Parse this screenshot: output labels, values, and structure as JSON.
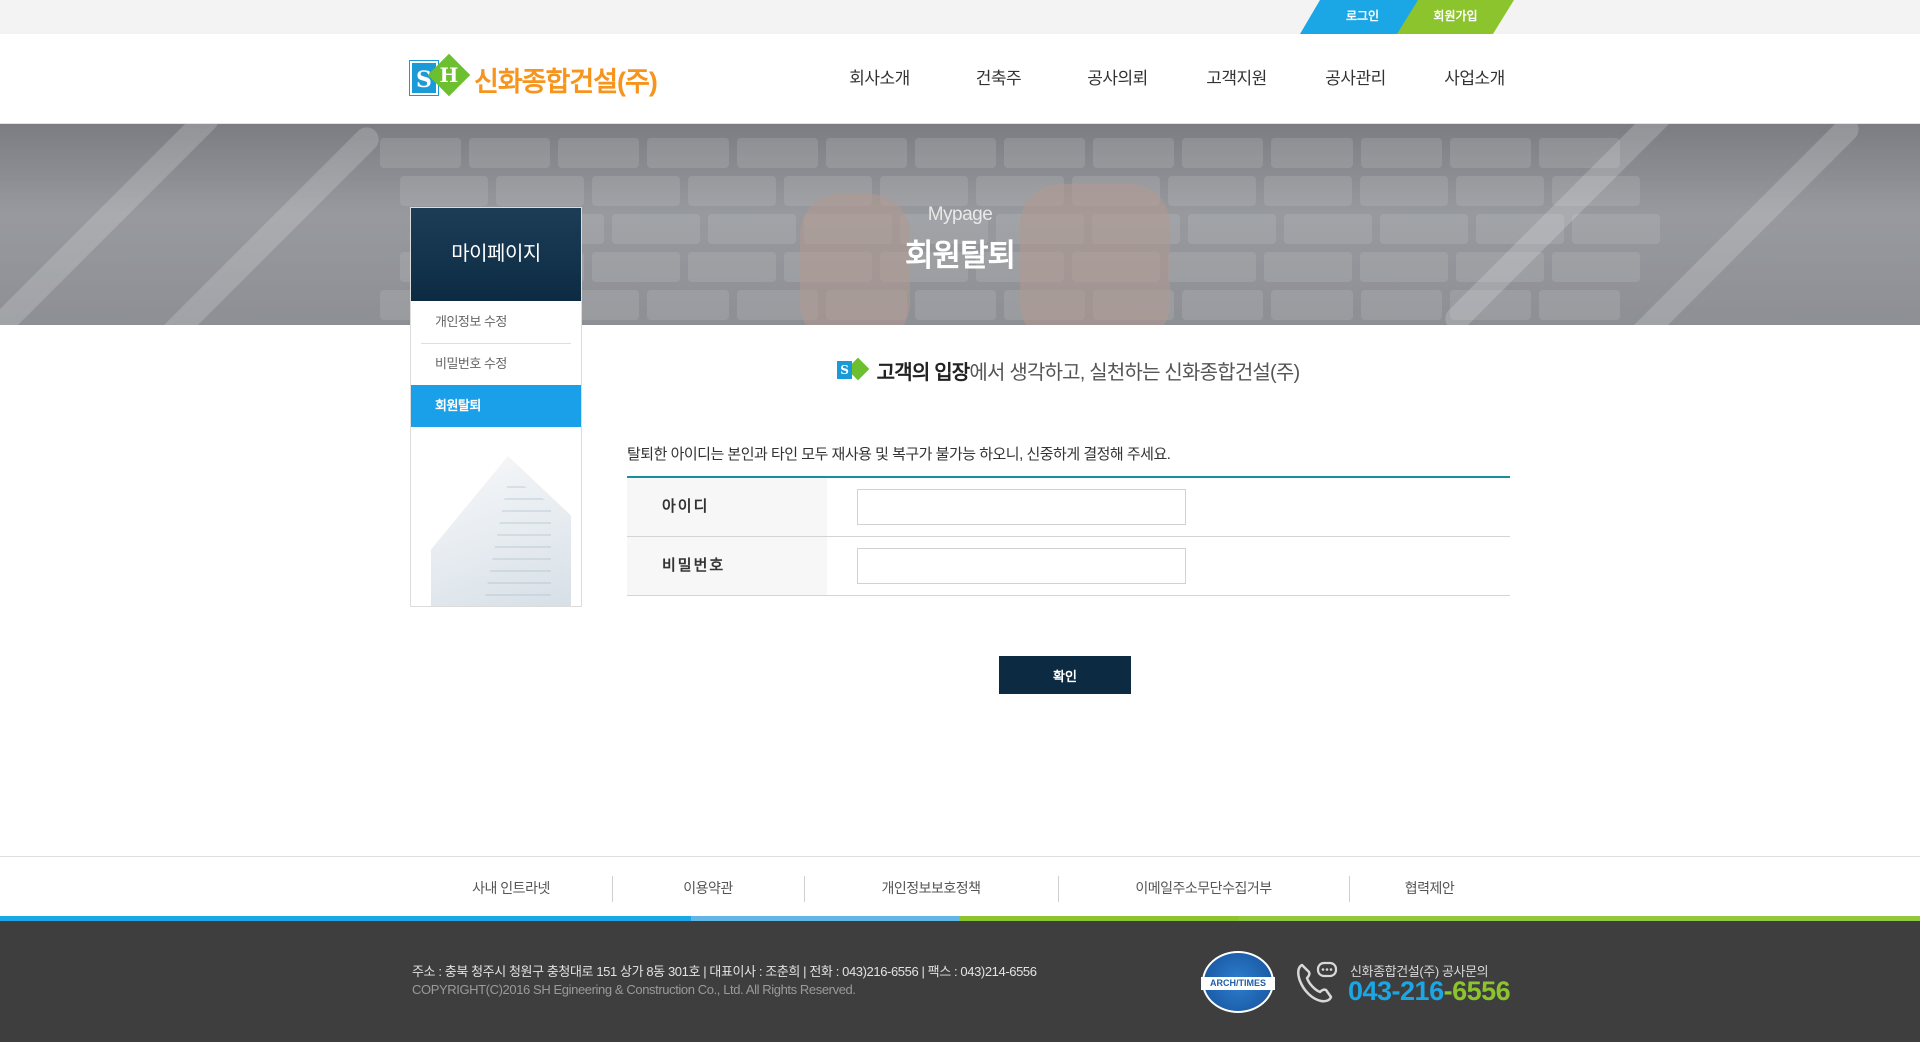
{
  "top": {
    "login": "로그인",
    "join": "회원가입"
  },
  "brand": {
    "s": "S",
    "h": "H",
    "name": "신화종합건설(주)"
  },
  "gnb": [
    "회사소개",
    "건축주",
    "공사의뢰",
    "고객지원",
    "공사관리",
    "사업소개"
  ],
  "banner": {
    "en": "Mypage",
    "ko": "회원탈퇴"
  },
  "side": {
    "title": "마이페이지",
    "items": [
      "개인정보 수정",
      "비밀번호 수정",
      "회원탈퇴"
    ]
  },
  "content": {
    "slogan_strong": "고객의 입장",
    "slogan_rest": "에서 생각하고, 실천하는 신화종합건설(주)",
    "notice": "탈퇴한 아이디는 본인과 타인 모두 재사용 및 복구가 불가능 하오니, 신중하게 결정해 주세요.",
    "fields": [
      {
        "label": "아이디",
        "value": ""
      },
      {
        "label": "비밀번호",
        "value": ""
      }
    ],
    "confirm": "확인"
  },
  "footer": {
    "links": [
      "사내 인트라넷",
      "이용약관",
      "개인정보보호정책",
      "이메일주소무단수집거부",
      "협력제안"
    ],
    "address": "주소 : 충북 청주시 청원구 충청대로 151 상가 8동 301호   |   대표이사 : 조춘희   |   전화 : 043)216-6556   |   팩스 : 043)214-6556",
    "copyright": "COPYRIGHT(C)2016  SH Egineering & Construction  Co., Ltd. All Rights Reserved.",
    "seal_text": "ARCH/TIMES",
    "cs_label": "신화종합건설(주) 공사문의",
    "cs_phone_a": "043-216",
    "cs_phone_b": "-6556"
  },
  "colors": {
    "blue": "#1ba6e6",
    "green": "#8cc42d",
    "navy": "#0c2b43",
    "orange": "#f7941d"
  }
}
